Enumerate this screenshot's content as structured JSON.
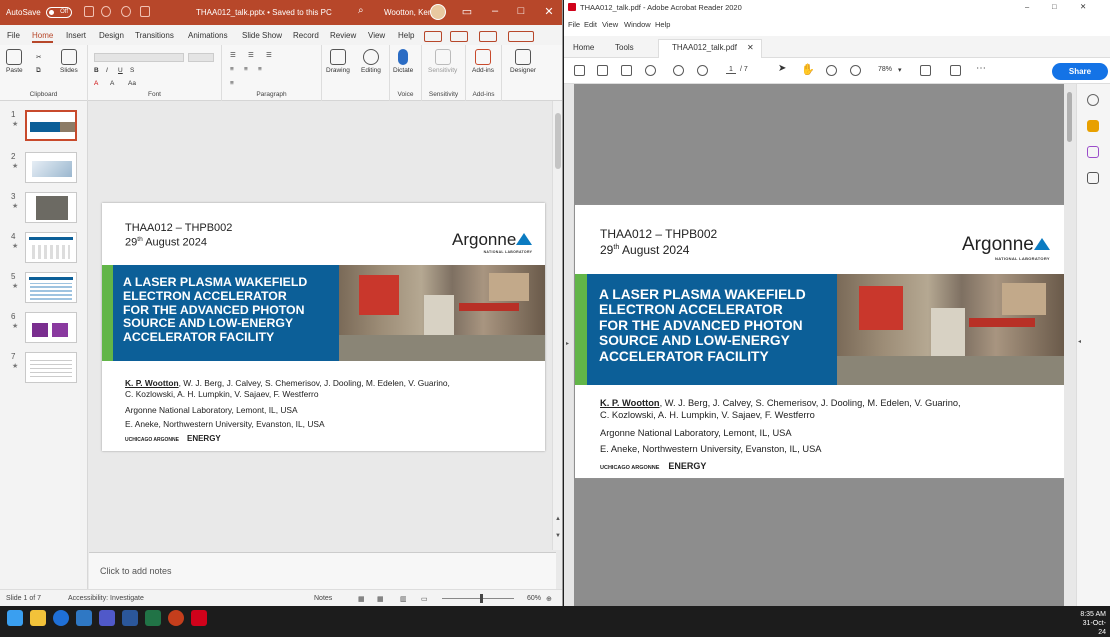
{
  "ppt": {
    "autosave_label": "AutoSave",
    "autosave_state": "Off",
    "doc_title": "THAA012_talk.pptx • Saved to this PC",
    "user": "Wootton, Kent",
    "tabs": [
      "File",
      "Home",
      "Insert",
      "Design",
      "Transitions",
      "Animations",
      "Slide Show",
      "Record",
      "Review",
      "View",
      "Help"
    ],
    "active_tab": "Home",
    "ribbon_groups": {
      "clipboard": "Clipboard",
      "font": "Font",
      "paragraph": "Paragraph",
      "voice": "Voice",
      "sensitivity": "Sensitivity",
      "addins": "Add-ins"
    },
    "ribbon_buttons": {
      "paste": "Paste",
      "slides": "Slides",
      "drawing": "Drawing",
      "editing": "Editing",
      "dictate": "Dictate",
      "sensitivity": "Sensitivity",
      "addins": "Add-ins",
      "designer": "Designer"
    },
    "thumb_numbers": [
      "1",
      "2",
      "3",
      "4",
      "5",
      "6",
      "7"
    ],
    "notes_placeholder": "Click to add notes",
    "status": {
      "slide": "Slide 1 of 7",
      "accessibility": "Accessibility: Investigate",
      "notes": "Notes",
      "zoom": "60%"
    }
  },
  "slide": {
    "code": "THAA012 – THPB002",
    "date_day": "29",
    "date_suffix": "th",
    "date_rest": " August 2024",
    "logo": "Argonne",
    "logo_sub": "NATIONAL LABORATORY",
    "title_lines": [
      "A LASER PLASMA WAKEFIELD",
      "ELECTRON ACCELERATOR",
      "FOR THE ADVANCED PHOTON",
      "SOURCE AND LOW-ENERGY",
      "ACCELERATOR FACILITY"
    ],
    "lead_author": "K. P. Wootton",
    "authors_line1_rest": ", W. J. Berg, J. Calvey, S. Chemerisov, J. Dooling, M. Edelen, V. Guarino,",
    "authors_line2": "C. Kozlowski, A. H. Lumpkin, V. Sajaev, F. Westferro",
    "affil1": "Argonne National Laboratory, Lemont, IL, USA",
    "affil2": "E. Aneke, Northwestern University, Evanston, IL, USA",
    "footer_uchicago": "UCHICAGO ARGONNE",
    "footer_energy": "ENERGY"
  },
  "acrobat": {
    "title": "THAA012_talk.pdf - Adobe Acrobat Reader 2020",
    "menu": [
      "File",
      "Edit",
      "View",
      "Window",
      "Help"
    ],
    "tabs": [
      "Home",
      "Tools"
    ],
    "doc_tab": "THAA012_talk.pdf",
    "page_current": "1",
    "page_total": "/ 7",
    "zoom": "78%",
    "share": "Share"
  },
  "taskbar": {
    "time": "8:35 AM",
    "date": "31-Oct-24"
  },
  "colors": {
    "ppt_accent": "#b7472a",
    "slide_blue": "#0c5f98",
    "slide_green": "#62b548",
    "acrobat_share": "#1473e6"
  }
}
